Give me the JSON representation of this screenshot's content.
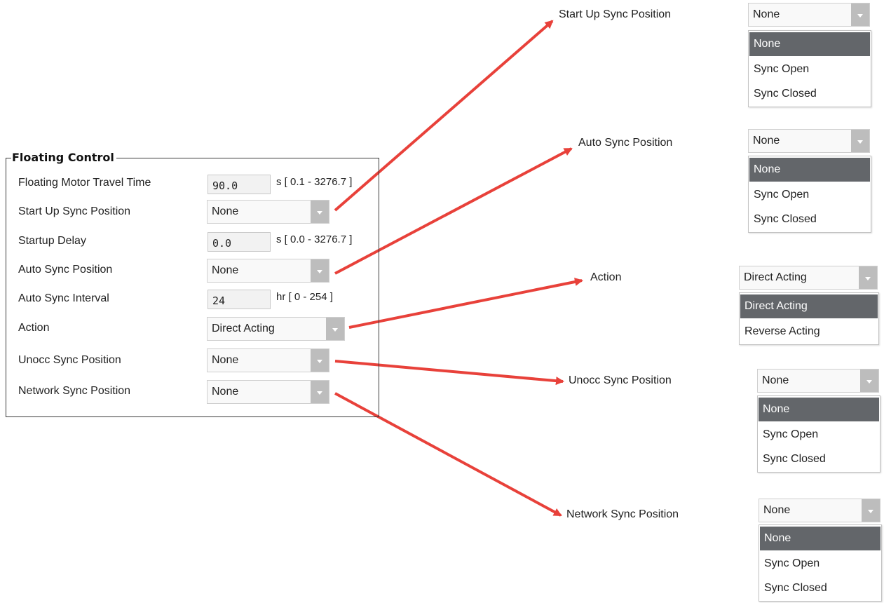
{
  "panel": {
    "title": "Floating Control",
    "rows": [
      {
        "label": "Floating Motor Travel Time",
        "value": "90.0",
        "unit": "s [ 0.1 - 3276.7 ]"
      },
      {
        "label": "Start Up Sync Position",
        "value": "None"
      },
      {
        "label": "Startup Delay",
        "value": "0.0",
        "unit": "s [ 0.0 - 3276.7 ]"
      },
      {
        "label": "Auto Sync Position",
        "value": "None"
      },
      {
        "label": "Auto Sync Interval",
        "value": "24",
        "unit": "hr [ 0 - 254 ]"
      },
      {
        "label": "Action",
        "value": "Direct Acting"
      },
      {
        "label": "Unocc Sync Position",
        "value": "None"
      },
      {
        "label": "Network Sync Position",
        "value": "None"
      }
    ]
  },
  "callouts": [
    {
      "label": "Start Up Sync Position",
      "selected": "None",
      "options": [
        "None",
        "Sync Open",
        "Sync Closed"
      ]
    },
    {
      "label": "Auto Sync Position",
      "selected": "None",
      "options": [
        "None",
        "Sync Open",
        "Sync Closed"
      ]
    },
    {
      "label": "Action",
      "selected": "Direct Acting",
      "options": [
        "Direct Acting",
        "Reverse Acting"
      ]
    },
    {
      "label": "Unocc Sync Position",
      "selected": "None",
      "options": [
        "None",
        "Sync Open",
        "Sync Closed"
      ]
    },
    {
      "label": "Network Sync Position",
      "selected": "None",
      "options": [
        "None",
        "Sync Open",
        "Sync Closed"
      ]
    }
  ],
  "colors": {
    "arrow": "#e8413a",
    "highlight": "#63666a",
    "dropdown_button": "#bdbdbd"
  }
}
